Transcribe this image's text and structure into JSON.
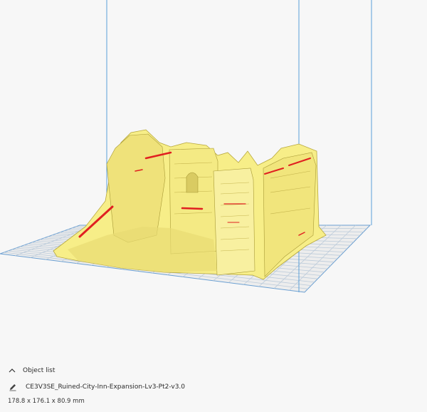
{
  "object_panel": {
    "header_label": "Object list",
    "file_name": "CE3V3SE_Ruined-City-Inn-Expansion-Lv3-Pt2-v3.0",
    "dimensions": "178.8 x 176.1 x 80.9 mm"
  },
  "colors": {
    "background": "#f7f7f7",
    "grid_line": "#b9c9da",
    "grid_border": "#6a9fd2",
    "model_fill": "#f7ee88",
    "model_shadow": "#c9b94d",
    "overhang": "#e02020",
    "build_volume": "#5a9fd8"
  },
  "icons": {
    "collapse": "chevron-up-icon",
    "edit": "pencil-icon"
  }
}
